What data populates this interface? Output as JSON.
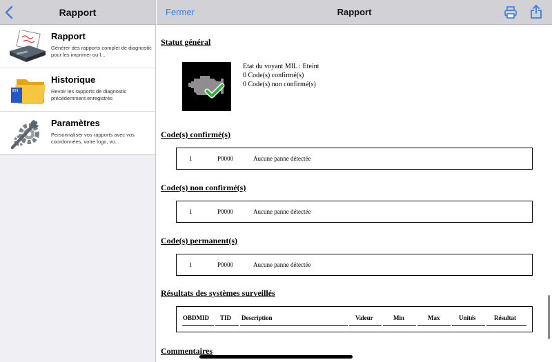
{
  "sidebar": {
    "title": "Rapport",
    "items": [
      {
        "label": "Rapport",
        "description": "Générer des rapports complet de diagnostic pour les imprimer ou l..."
      },
      {
        "label": "Historique",
        "description": "Revoir les rapports de diagnostic précédemment enregistrés"
      },
      {
        "label": "Paramètres",
        "description": "Personnaliser vos rapports avec vos coordonnées, votre logo, vo..."
      }
    ]
  },
  "header": {
    "close_label": "Fermer",
    "title": "Rapport",
    "accent": "#3d7fd6"
  },
  "report": {
    "general_status": {
      "title": "Statut général",
      "mil_status": "Etat du voyant MIL : Eteint",
      "confirmed_count": "0 Code(s) confirmé(s)",
      "unconfirmed_count": "0 Code(s) non confirmé(s)",
      "icon": "engine-check-icon"
    },
    "confirmed": {
      "title": "Code(s) confirmé(s)",
      "rows": [
        {
          "index": "1",
          "code": "P0000",
          "description": "Aucune panne détectée"
        }
      ]
    },
    "unconfirmed": {
      "title": "Code(s) non confirmé(s)",
      "rows": [
        {
          "index": "1",
          "code": "P0000",
          "description": "Aucune panne détectée"
        }
      ]
    },
    "permanent": {
      "title": "Code(s) permanent(s)",
      "rows": [
        {
          "index": "1",
          "code": "P0000",
          "description": "Aucune panne détectée"
        }
      ]
    },
    "monitors": {
      "title": "Résultats des systèmes surveillés",
      "columns": [
        "OBDMID",
        "TID",
        "Description",
        "Valeur",
        "Min",
        "Max",
        "Unités",
        "Résultat"
      ]
    },
    "comments": {
      "title": "Commentaires"
    }
  }
}
